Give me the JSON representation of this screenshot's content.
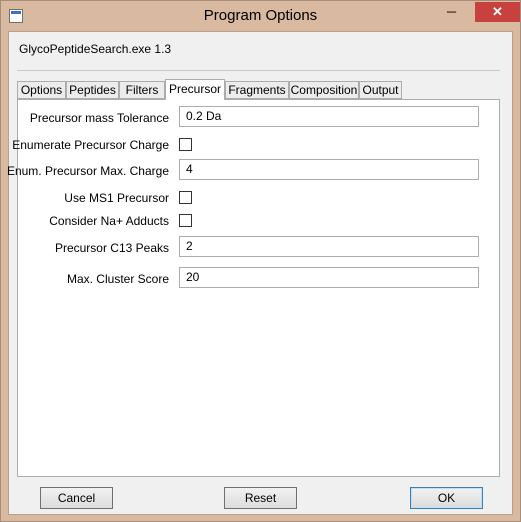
{
  "window": {
    "title": "Program Options",
    "min_glyph": "─",
    "max_glyph": "□",
    "close_glyph": "✕"
  },
  "app_version": "GlycoPeptideSearch.exe 1.3",
  "tabs": [
    {
      "label": "Options"
    },
    {
      "label": "Peptides"
    },
    {
      "label": "Filters"
    },
    {
      "label": "Precursor"
    },
    {
      "label": "Fragments"
    },
    {
      "label": "Composition"
    },
    {
      "label": "Output"
    }
  ],
  "active_tab": "Precursor",
  "precursor": {
    "mass_tolerance_label": "Precursor mass Tolerance",
    "mass_tolerance_value": "0.2 Da",
    "enumerate_charge_label": "Enumerate Precursor Charge",
    "enumerate_charge_checked": false,
    "enum_max_charge_label": "Enum. Precursor Max. Charge",
    "enum_max_charge_value": "4",
    "use_ms1_label": "Use MS1 Precursor",
    "use_ms1_checked": false,
    "na_adducts_label": "Consider Na+ Adducts",
    "na_adducts_checked": false,
    "c13_peaks_label": "Precursor C13 Peaks",
    "c13_peaks_value": "2",
    "max_cluster_label": "Max. Cluster Score",
    "max_cluster_value": "20"
  },
  "buttons": {
    "cancel": "Cancel",
    "reset": "Reset",
    "ok": "OK"
  }
}
